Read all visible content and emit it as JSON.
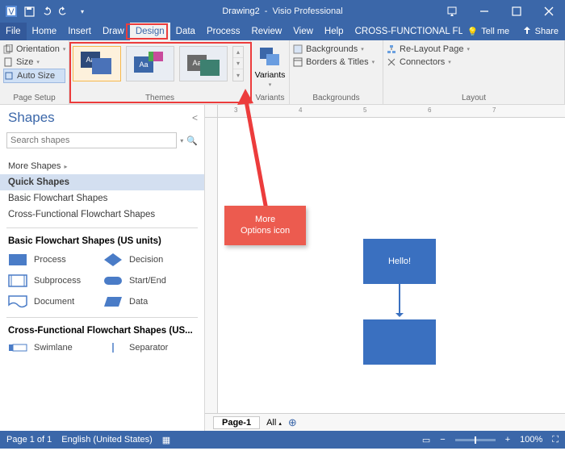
{
  "title": {
    "doc": "Drawing2",
    "sep": "-",
    "app": "Visio Professional"
  },
  "tabs": {
    "file": "File",
    "list": [
      "Home",
      "Insert",
      "Draw",
      "Design",
      "Data",
      "Process",
      "Review",
      "View",
      "Help",
      "CROSS-FUNCTIONAL FLOW"
    ],
    "active_index": 3,
    "tellme": "Tell me",
    "share": "Share"
  },
  "ribbon": {
    "pagesetup": {
      "orientation": "Orientation",
      "size": "Size",
      "autosize": "Auto Size",
      "label": "Page Setup"
    },
    "themes": {
      "label": "Themes",
      "aa": "Aa"
    },
    "variants": {
      "btn": "Variants",
      "label": "Variants"
    },
    "backgrounds": {
      "bg": "Backgrounds",
      "borders": "Borders & Titles",
      "label": "Backgrounds"
    },
    "layout": {
      "relayout": "Re-Layout Page",
      "connectors": "Connectors",
      "label": "Layout"
    }
  },
  "shapes": {
    "title": "Shapes",
    "search_ph": "Search shapes",
    "more": "More Shapes",
    "cats": [
      "Quick Shapes",
      "Basic Flowchart Shapes",
      "Cross-Functional Flowchart Shapes"
    ],
    "sec1_title": "Basic Flowchart Shapes (US units)",
    "sec1": [
      "Process",
      "Decision",
      "Subprocess",
      "Start/End",
      "Document",
      "Data"
    ],
    "sec2_title": "Cross-Functional Flowchart Shapes (US...",
    "sec2": [
      "Swimlane",
      "Separator"
    ]
  },
  "canvas": {
    "shape_text": "Hello!",
    "page_tab": "Page-1",
    "all": "All",
    "ruler": [
      "3",
      "4",
      "5",
      "6",
      "7"
    ]
  },
  "status": {
    "page": "Page 1 of 1",
    "lang": "English (United States)",
    "zoom": "100%"
  },
  "annotation": {
    "line1": "More",
    "line2": "Options icon"
  }
}
